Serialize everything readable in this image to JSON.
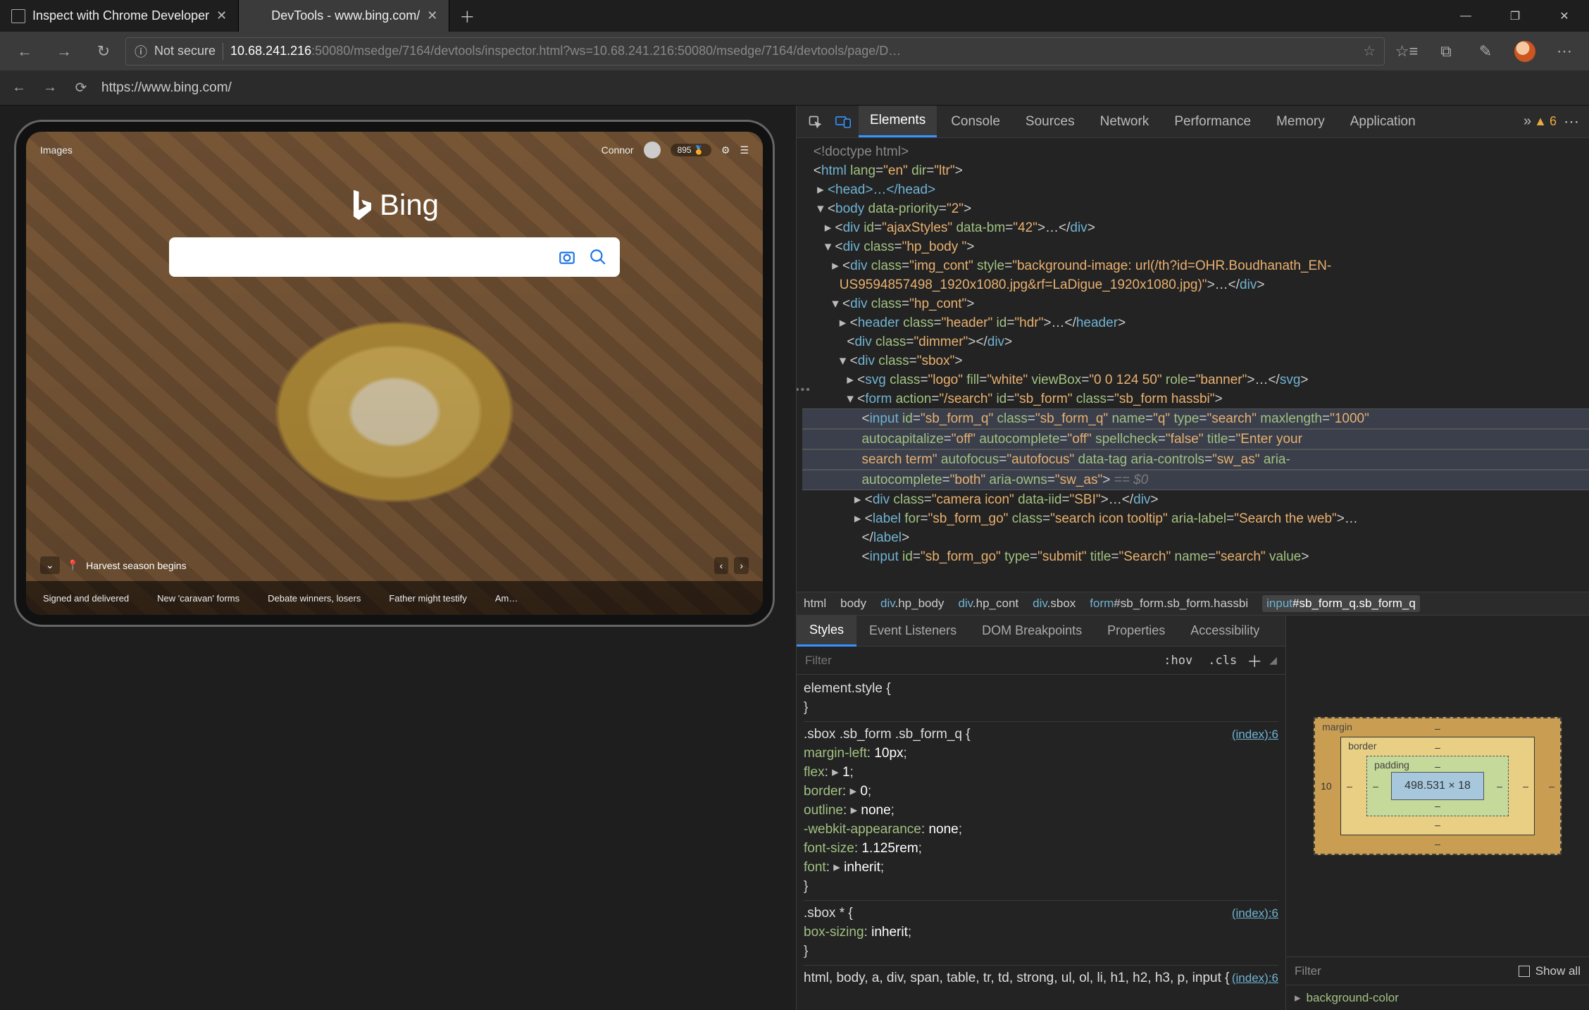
{
  "window": {
    "tabs": [
      {
        "title": "Inspect with Chrome Developer",
        "icon": "page"
      },
      {
        "title": "DevTools - www.bing.com/",
        "icon": "edge"
      }
    ],
    "controls": {
      "min": "—",
      "max": "❐",
      "close": "✕"
    }
  },
  "toolbar": {
    "secure_label": "Not secure",
    "url_host": "10.68.241.216",
    "url_rest": ":50080/msedge/7164/devtools/inspector.html?ws=10.68.241.216:50080/msedge/7164/devtools/page/D…"
  },
  "subbar": {
    "url": "https://www.bing.com/"
  },
  "bing": {
    "top_left": "Images",
    "user": "Connor",
    "points": "895",
    "logo": "Bing",
    "caption": "Harvest season begins",
    "news": [
      "Signed and delivered",
      "New 'caravan' forms",
      "Debate winners, losers",
      "Father might testify",
      "Am…"
    ]
  },
  "devtools": {
    "tabs": [
      "Elements",
      "Console",
      "Sources",
      "Network",
      "Performance",
      "Memory",
      "Application"
    ],
    "active_tab": "Elements",
    "warn_count": "6",
    "dom": {
      "doctype": "<!doctype html>",
      "l1": {
        "tag": "html",
        "attrs": "lang=\"en\" dir=\"ltr\""
      },
      "head": "<head>…</head>",
      "body": {
        "tag": "body",
        "attrs": "data-priority=\"2\""
      },
      "ajax": {
        "tag": "div",
        "attrs": "id=\"ajaxStyles\" data-bm=\"42\"",
        "tail": "…</div>"
      },
      "hpbody": {
        "tag": "div",
        "attrs": "class=\"hp_body \""
      },
      "imgcont": {
        "tag": "div",
        "attrs": "class=\"img_cont\" style=\"background-image: url(/th?id=OHR.Boudhanath_EN-US9594857498_1920x1080.jpg&rf=LaDigue_1920x1080.jpg)\"",
        "tail": "…</div>"
      },
      "hpcont": {
        "tag": "div",
        "attrs": "class=\"hp_cont\""
      },
      "header": {
        "tag": "header",
        "attrs": "class=\"header\" id=\"hdr\"",
        "tail": "…</header>"
      },
      "dimmer": {
        "tag": "div",
        "attrs": "class=\"dimmer\"",
        "tail": "</div>"
      },
      "sbox": {
        "tag": "div",
        "attrs": "class=\"sbox\""
      },
      "svg": {
        "tag": "svg",
        "attrs": "class=\"logo\" fill=\"white\" viewBox=\"0 0 124 50\" role=\"banner\"",
        "tail": "…</svg>"
      },
      "form": {
        "tag": "form",
        "attrs": "action=\"/search\" id=\"sb_form\" class=\"sb_form hassbi\""
      },
      "input1_line1": "<input id=\"sb_form_q\" class=\"sb_form_q\" name=\"q\" type=\"search\" maxlength=\"1000\"",
      "input1_line2": "autocapitalize=\"off\" autocomplete=\"off\" spellcheck=\"false\" title=\"Enter your",
      "input1_line3": "search term\" autofocus=\"autofocus\" data-tag aria-controls=\"sw_as\" aria-",
      "input1_line4": "autocomplete=\"both\" aria-owns=\"sw_as\">",
      "eq0": " == $0",
      "camera": {
        "tag": "div",
        "attrs": "class=\"camera icon\" data-iid=\"SBI\"",
        "tail": "…</div>"
      },
      "label": {
        "tag": "label",
        "attrs": "for=\"sb_form_go\" class=\"search icon tooltip\" aria-label=\"Search the web\"",
        "tail": "…"
      },
      "label_close": "</label>",
      "input2": "<input id=\"sb_form_go\" type=\"submit\" title=\"Search\" name=\"search\" value>"
    },
    "breadcrumb": [
      {
        "t": "html"
      },
      {
        "t": "body"
      },
      {
        "t": "div",
        "s": ".hp_body"
      },
      {
        "t": "div",
        "s": ".hp_cont"
      },
      {
        "t": "div",
        "s": ".sbox"
      },
      {
        "t": "form",
        "s": "#sb_form.sb_form.hassbi"
      },
      {
        "t": "input",
        "s": "#sb_form_q.sb_form_q"
      }
    ],
    "styles_tabs": [
      "Styles",
      "Event Listeners",
      "DOM Breakpoints",
      "Properties",
      "Accessibility"
    ],
    "styles_filter": "Filter",
    "hov": ":hov",
    "cls": ".cls",
    "css": {
      "rule0": "element.style {",
      "rule1_sel": ".sbox .sb_form .sb_form_q {",
      "rule1_link": "(index):6",
      "rule1_props": [
        [
          "margin-left",
          "10px;",
          false
        ],
        [
          "flex",
          "1;",
          true
        ],
        [
          "border",
          "0;",
          true
        ],
        [
          "outline",
          "none;",
          true
        ],
        [
          "-webkit-appearance",
          "none;",
          false
        ],
        [
          "font-size",
          "1.125rem;",
          false
        ],
        [
          "font",
          "inherit;",
          true
        ]
      ],
      "rule2_sel": ".sbox * {",
      "rule2_link": "(index):6",
      "rule2_props": [
        [
          "box-sizing",
          "inherit;",
          false
        ]
      ],
      "rule3_sel": "html, body, a, div, span, table, tr, td, strong, ul, ol, li, h1, h2, h3, p, input {",
      "rule3_link": "(index):6"
    },
    "box": {
      "labels": {
        "margin": "margin",
        "border": "border",
        "padding": "padding"
      },
      "margin": {
        "t": "–",
        "r": "–",
        "b": "–",
        "l": "10"
      },
      "border": {
        "t": "–",
        "r": "–",
        "b": "–",
        "l": "–"
      },
      "padding": {
        "t": "–",
        "r": "–",
        "b": "–",
        "l": "–"
      },
      "content": "498.531 × 18"
    },
    "bp_filter": "Filter",
    "showall": "Show all",
    "bp_item": "background-color"
  }
}
